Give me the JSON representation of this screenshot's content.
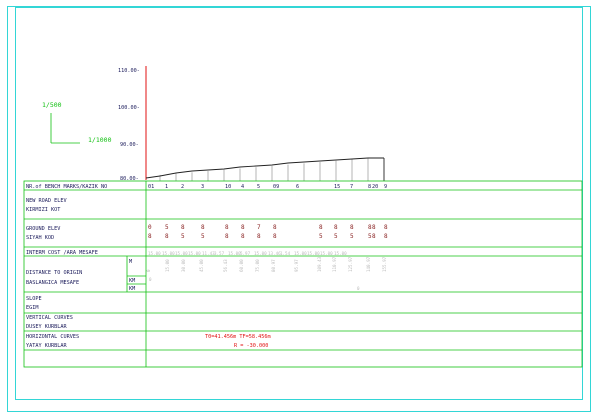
{
  "axis": {
    "ticks": [
      "80.00-",
      "90.00-",
      "100.00-",
      "110.00-"
    ]
  },
  "scale": {
    "vertical": "1/500",
    "horizontal": "1/1000"
  },
  "rows": {
    "bench": "NR.of BENCH MARKS/KAZIK NO",
    "new_road_elev": "NEW ROAD ELEV",
    "kirmizi_kot": "KIRMIZI KOT",
    "ground_elev": "GROUND ELEV",
    "siyah_kod": "SIYAH KOD",
    "interm_cost": "INTERM COST /ARA MESAFE",
    "distance_origin": "DISTANCE TO ORIGIN",
    "baslangica": "BASLANGICA MESAFE",
    "slope": "SLOPE",
    "egim": "EGIM",
    "vertical_curves": "VERTICAL CURVES",
    "dusey_kurblar": "DUSEY KURBLAR",
    "horizontal_curves": "HORIZONTAL CURVES",
    "yatay_kurblar": "YATAY KURBLAR"
  },
  "sub_labels": [
    "M",
    "KM",
    "KM"
  ],
  "curve": {
    "tangents": "T0=41.456m      TF=58.456m",
    "radius": "R = -30.000"
  },
  "station_numbers": [
    "01",
    "1",
    "2",
    "3",
    "10",
    "4",
    "5",
    "09",
    "6",
    "",
    "15",
    "7",
    "8",
    "9",
    "20"
  ],
  "ground_values_top": [
    "0",
    "5",
    "8",
    "8",
    "8",
    "8",
    "7",
    "8",
    "",
    "8",
    "8",
    "8",
    "8",
    "8",
    "8"
  ],
  "ground_values_bottom": [
    "8",
    "8",
    "5",
    "5",
    "8",
    "8",
    "8",
    "8",
    "",
    "5",
    "5",
    "5",
    "5",
    "8",
    "8"
  ],
  "interm_values": [
    "15.00",
    "15.00",
    "15.00",
    "15.00",
    "11.43",
    "3.57",
    "15.00",
    "5.97",
    "15.00",
    "13.46",
    "1.54",
    "15.00",
    "15.00",
    "15.00",
    "15.00"
  ],
  "distance_values": [
    "0",
    "15.00",
    "30.00",
    "45.00",
    "56.43",
    "60.00",
    "75.00",
    "80.97",
    "95.97",
    "109.43",
    "110.97",
    "125.97",
    "140.97",
    "155.97",
    "170.97"
  ],
  "km_values": [
    "0",
    "0"
  ],
  "colors": {
    "frame": "#33d6d6",
    "grid": "#12c012",
    "axis": "#e01010",
    "profile": "#222222"
  }
}
